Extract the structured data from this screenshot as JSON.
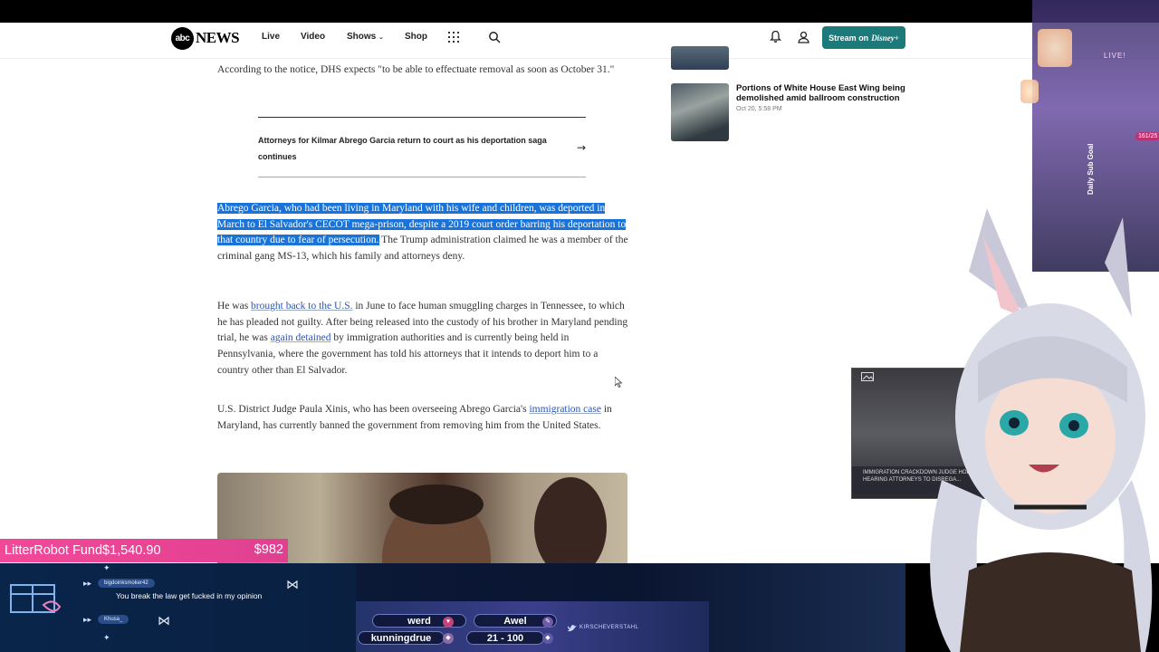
{
  "nav": {
    "logo_mark": "abc",
    "logo_text": "NEWS",
    "live": "Live",
    "video": "Video",
    "shows": "Shows",
    "shop": "Shop",
    "stream_label": "Stream on",
    "stream_brand": "Disney+"
  },
  "article": {
    "p1": "According to the notice, DHS expects \"to be able to effectuate removal as soon as October 31.\"",
    "related": "Attorneys for Kilmar Abrego Garcia return to court as his deportation saga continues",
    "p2_highlight": "Abrego Garcia, who had been living in Maryland with his wife and children, was deported in March to El Salvador's CECOT mega-prison, despite a 2019 court order barring his deportation to that country due to fear of persecution.",
    "p2_rest": " The Trump administration claimed he was a member of the criminal gang MS-13, which his family and attorneys deny.",
    "p3_a": "He was ",
    "p3_link1": "brought back to the U.S.",
    "p3_b": " in June to face human smuggling charges in Tennessee, to which he has pleaded not guilty. After being released into the custody of his brother in Maryland pending trial, he was ",
    "p3_link2": "again detained",
    "p3_c": " by immigration authorities and is currently being held in Pennsylvania, where the government has told his attorneys that it intends to deport him to a country other than El Salvador.",
    "p4_a": "U.S. District Judge Paula Xinis, who has been overseeing Abrego Garcia's ",
    "p4_link": "immigration case",
    "p4_b": " in Maryland, has currently banned the government from removing him from the United States."
  },
  "sidebar": {
    "item2_title": "Portions of White House East Wing being demolished amid ballroom construction",
    "item2_date": "Oct 20, 5:58 PM"
  },
  "overlay": {
    "live": "LIVE!",
    "subgoal": "Daily Sub Goal",
    "subcount": "161/25",
    "goal_name": "LitterRobot Fund",
    "goal_progress": "$1,540.90",
    "goal_amount": "$982",
    "cam_chyron": "IMMIGRATION CRACKDOWN JUDGE HOLDS HEARING ATTORNEYS TO DISREGA...",
    "chat": [
      {
        "user": "bigdoinksmoker42",
        "msg": "You break the law get fucked in my opinion"
      },
      {
        "user": "Khusa_",
        "msg": ""
      }
    ],
    "subs": [
      "werd",
      "Awel",
      "kunningdrue",
      "21 - 100"
    ],
    "social": "KIRSCHEVERSTAHL"
  },
  "colors": {
    "accent": "#1c7a7a",
    "highlight": "#1a73d9",
    "link": "#2b55b8",
    "goal_bar": "#f3489a"
  }
}
